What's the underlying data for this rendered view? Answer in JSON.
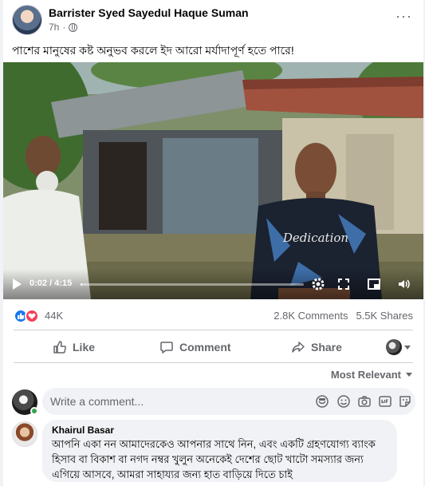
{
  "post": {
    "author": "Barrister Syed Sayedul Haque Suman",
    "time": "7h",
    "dot": "·",
    "caption": "পাশের মানুষের কষ্ট অনুভব করলে ইদ আরো মর্যাদাপূর্ণ হতে পারে!",
    "more_label": "···"
  },
  "video": {
    "elapsed": "0:02",
    "total": "4:15",
    "time_display": "0:02 / 4:15",
    "progress_fraction": 0.008,
    "shirt_text": "Dedication"
  },
  "stats": {
    "reaction_count": "44K",
    "comments": "2.8K Comments",
    "shares": "5.5K Shares"
  },
  "actions": {
    "like": "Like",
    "comment": "Comment",
    "share": "Share"
  },
  "sort": {
    "label": "Most Relevant"
  },
  "composer": {
    "placeholder": "Write a comment..."
  },
  "comments": [
    {
      "name": "Khairul Basar",
      "text": "আপনি একা নন আমাদেরকেও আপনার সাথে নিন, এবং একটি গ্রহণযোগ্য ব্যাংক হিসাব বা বিকাশ বা নগদ নম্বর খুলুন অনেকেই দেশের ছোট খাটো সমস্যার জন্য এগিয়ে আসবে, আমরা সাহায্যর জন্য হাত বাড়িয়ে দিতে চাই"
    }
  ],
  "colors": {
    "accent": "#1877f2",
    "love": "#f33e58",
    "secondary_text": "#65676b",
    "bubble": "#f0f2f5"
  },
  "icons": {
    "like": "thumbs-up-icon",
    "comment": "speech-bubble-icon",
    "share": "share-arrow-icon",
    "settings": "gear-icon",
    "fullscreen": "expand-icon",
    "pip": "picture-in-picture-icon",
    "volume": "speaker-icon"
  }
}
